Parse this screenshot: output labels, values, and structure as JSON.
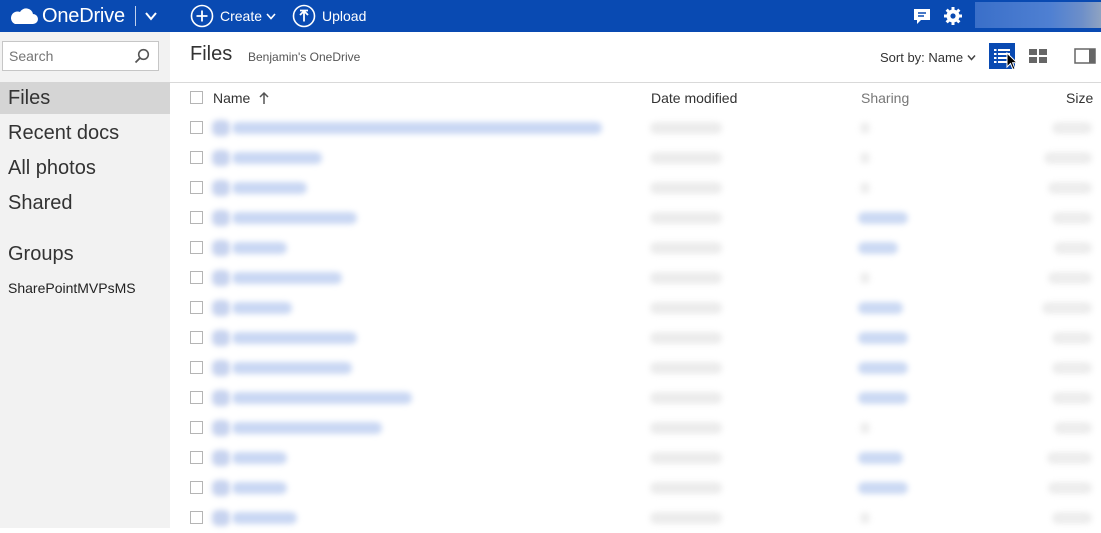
{
  "app": {
    "brand": "OneDrive",
    "brand_color": "#094ab2",
    "create_label": "Create",
    "upload_label": "Upload",
    "icons": [
      "cloud-logo-icon",
      "chevron-down-icon",
      "plus-circle-icon",
      "upload-circle-icon",
      "feedback-icon",
      "gear-icon",
      "search-icon",
      "list-view-icon",
      "tiles-view-icon",
      "details-pane-icon",
      "sort-arrow-up-icon"
    ]
  },
  "sidebar": {
    "search_placeholder": "Search",
    "items": [
      {
        "label": "Files",
        "selected": true
      },
      {
        "label": "Recent docs",
        "selected": false
      },
      {
        "label": "All photos",
        "selected": false
      },
      {
        "label": "Shared",
        "selected": false
      }
    ],
    "groups_heading": "Groups",
    "groups": [
      {
        "label": "SharePointMVPsMS"
      }
    ]
  },
  "main": {
    "title": "Files",
    "breadcrumb": "Benjamin's OneDrive",
    "sort_label": "Sort by: Name",
    "columns": {
      "name": "Name",
      "date": "Date modified",
      "sharing": "Sharing",
      "size": "Size"
    },
    "row_count": 14
  }
}
